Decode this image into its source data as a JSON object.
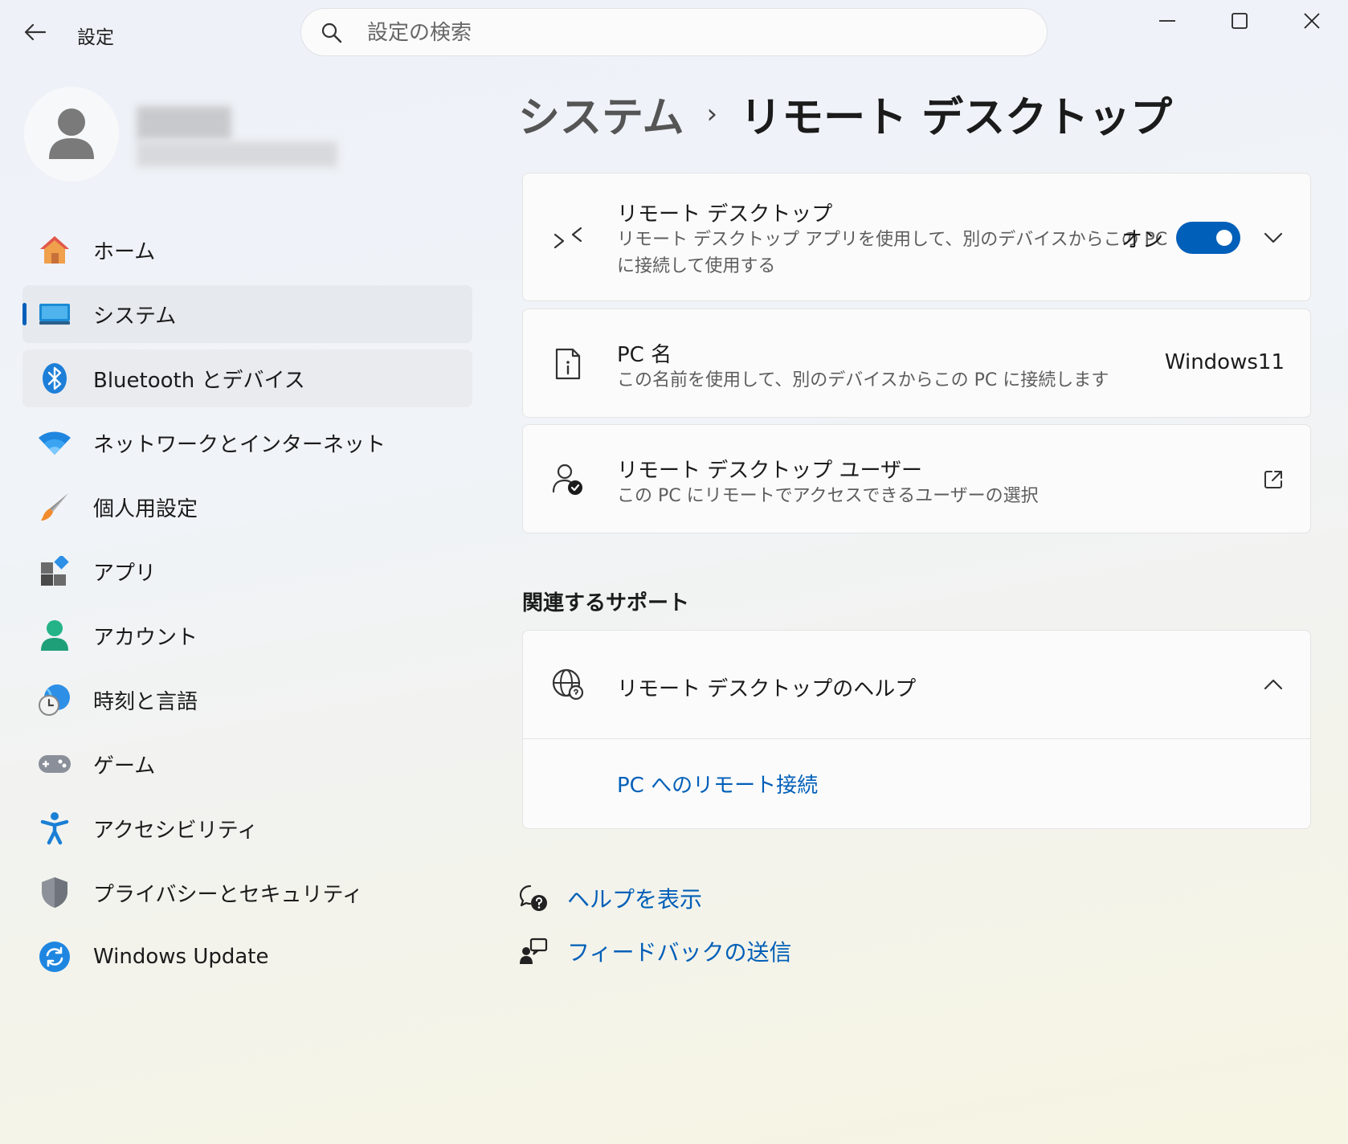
{
  "titlebar": {
    "app_title": "設定",
    "search_placeholder": "設定の検索"
  },
  "sidebar": {
    "items": [
      {
        "label": "ホーム",
        "icon": "home-icon"
      },
      {
        "label": "システム",
        "icon": "system-icon",
        "active": true
      },
      {
        "label": "Bluetooth とデバイス",
        "icon": "bluetooth-icon"
      },
      {
        "label": "ネットワークとインターネット",
        "icon": "wifi-icon"
      },
      {
        "label": "個人用設定",
        "icon": "brush-icon"
      },
      {
        "label": "アプリ",
        "icon": "apps-icon"
      },
      {
        "label": "アカウント",
        "icon": "account-icon"
      },
      {
        "label": "時刻と言語",
        "icon": "time-language-icon"
      },
      {
        "label": "ゲーム",
        "icon": "gamepad-icon"
      },
      {
        "label": "アクセシビリティ",
        "icon": "accessibility-icon"
      },
      {
        "label": "プライバシーとセキュリティ",
        "icon": "shield-icon"
      },
      {
        "label": "Windows Update",
        "icon": "update-icon"
      }
    ]
  },
  "breadcrumb": {
    "parent": "システム",
    "separator": "›",
    "current": "リモート デスクトップ"
  },
  "remote_desktop": {
    "title": "リモート デスクトップ",
    "desc_line1": "リモート デスクトップ アプリを使用して、別のデバイスからこの PC",
    "desc_line2": "に接続して使用する",
    "state_label": "オン",
    "enabled": true
  },
  "pc_name": {
    "title": "PC 名",
    "desc": "この名前を使用して、別のデバイスからこの PC に接続します",
    "value": "Windows11"
  },
  "rd_users": {
    "title": "リモート デスクトップ ユーザー",
    "desc": "この PC にリモートでアクセスできるユーザーの選択"
  },
  "related": {
    "section_title": "関連するサポート",
    "help_title": "リモート デスクトップのヘルプ",
    "help_link": "PC へのリモート接続"
  },
  "footer_links": {
    "get_help": "ヘルプを表示",
    "feedback": "フィードバックの送信"
  },
  "colors": {
    "accent": "#005fb8",
    "card_bg": "#fbfbfb",
    "text_secondary": "#5d5d5d"
  }
}
